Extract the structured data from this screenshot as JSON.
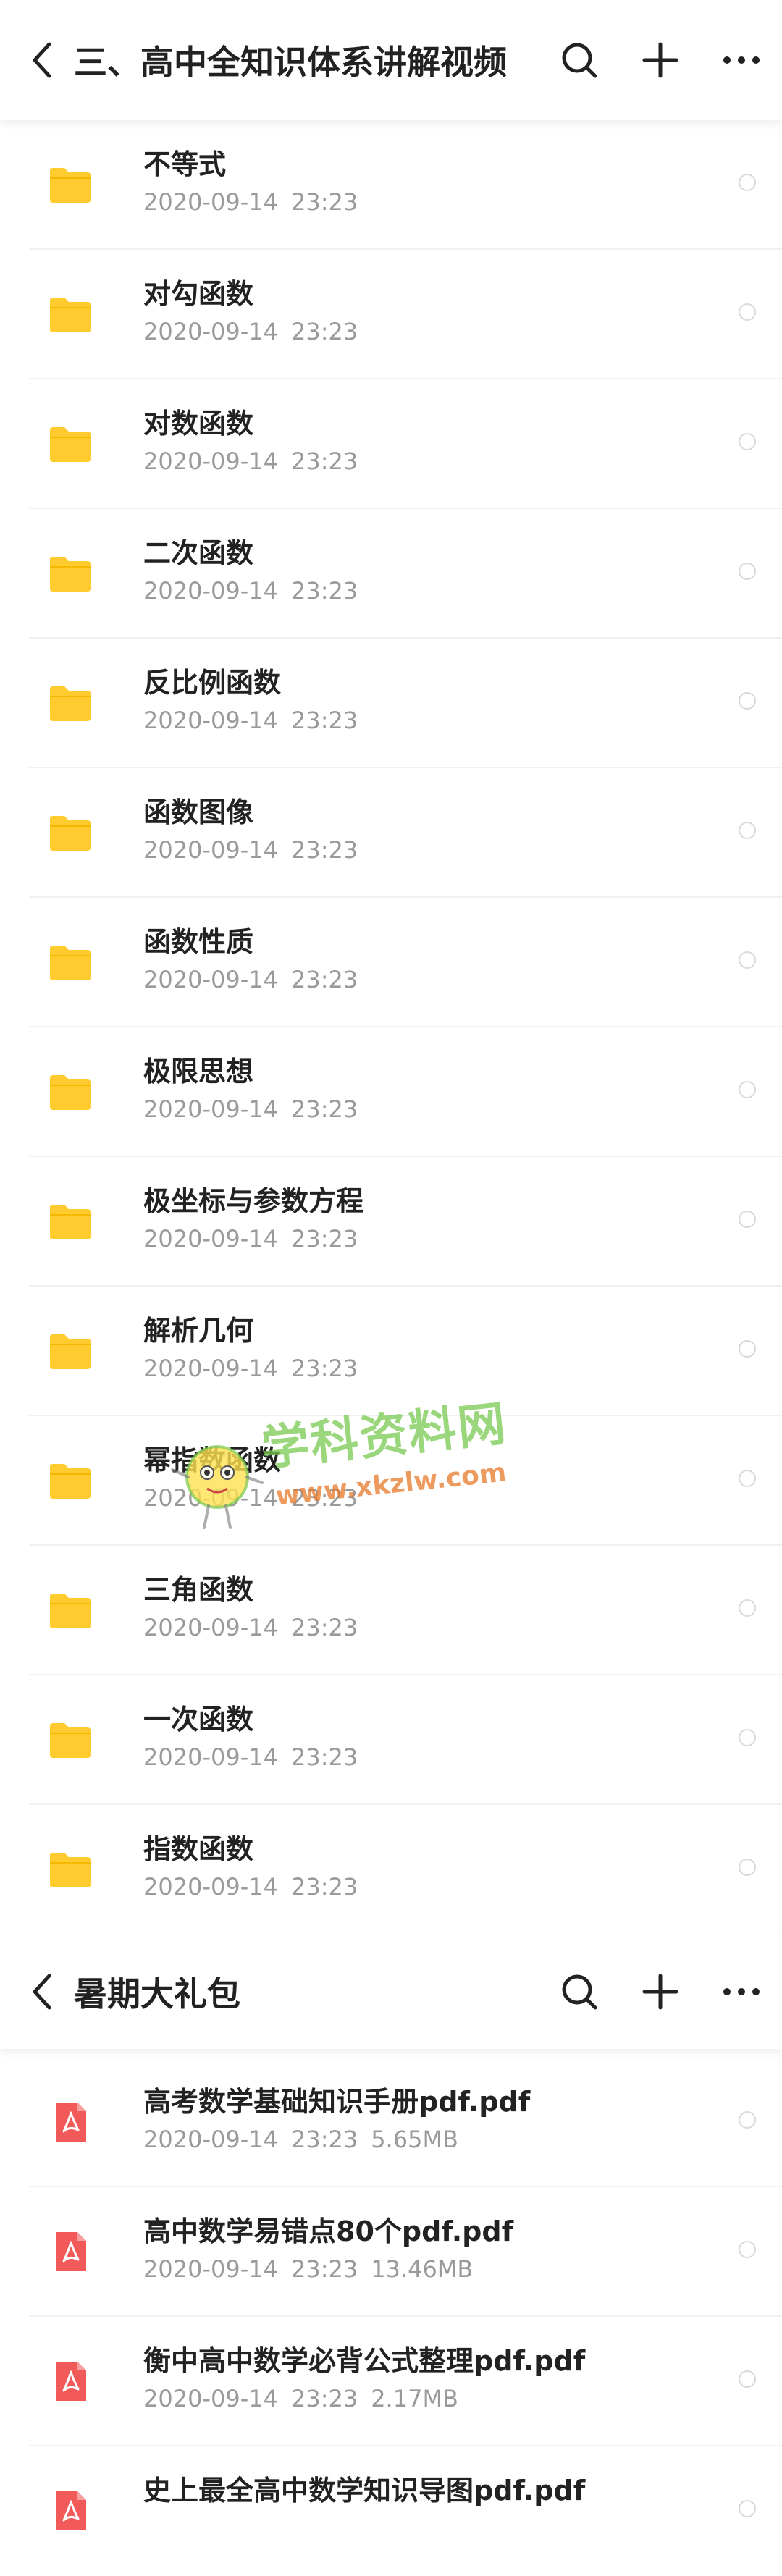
{
  "section1": {
    "title": "三、高中全知识体系讲解视频",
    "items": [
      {
        "name": "不等式",
        "date": "2020-09-14",
        "time": "23:23"
      },
      {
        "name": "对勾函数",
        "date": "2020-09-14",
        "time": "23:23"
      },
      {
        "name": "对数函数",
        "date": "2020-09-14",
        "time": "23:23"
      },
      {
        "name": "二次函数",
        "date": "2020-09-14",
        "time": "23:23"
      },
      {
        "name": "反比例函数",
        "date": "2020-09-14",
        "time": "23:23"
      },
      {
        "name": "函数图像",
        "date": "2020-09-14",
        "time": "23:23"
      },
      {
        "name": "函数性质",
        "date": "2020-09-14",
        "time": "23:23"
      },
      {
        "name": "极限思想",
        "date": "2020-09-14",
        "time": "23:23"
      },
      {
        "name": "极坐标与参数方程",
        "date": "2020-09-14",
        "time": "23:23"
      },
      {
        "name": "解析几何",
        "date": "2020-09-14",
        "time": "23:23"
      },
      {
        "name": "幂指数函数",
        "date": "2020-09-14",
        "time": "23:23"
      },
      {
        "name": "三角函数",
        "date": "2020-09-14",
        "time": "23:23"
      },
      {
        "name": "一次函数",
        "date": "2020-09-14",
        "time": "23:23"
      },
      {
        "name": "指数函数",
        "date": "2020-09-14",
        "time": "23:23"
      }
    ]
  },
  "section2": {
    "title": "暑期大礼包",
    "items": [
      {
        "name": "高考数学基础知识手册pdf.pdf",
        "date": "2020-09-14",
        "time": "23:23",
        "size": "5.65MB"
      },
      {
        "name": "高中数学易错点80个pdf.pdf",
        "date": "2020-09-14",
        "time": "23:23",
        "size": "13.46MB"
      },
      {
        "name": "衡中高中数学必背公式整理pdf.pdf",
        "date": "2020-09-14",
        "time": "23:23",
        "size": "2.17MB"
      },
      {
        "name": "史上最全高中数学知识导图pdf.pdf",
        "date": "",
        "time": "",
        "size": ""
      }
    ]
  },
  "watermark": {
    "brand": "学科资料网",
    "url": "www.xkzlw.com"
  },
  "icons": {
    "folder": "folder-icon",
    "pdf": "pdf-icon",
    "back": "back-arrow-icon",
    "search": "search-icon",
    "add": "plus-icon",
    "more": "more-icon"
  },
  "colors": {
    "folder": "#FFCB2F",
    "pdf": "#F25A5A",
    "meta": "#9A9A9A"
  }
}
